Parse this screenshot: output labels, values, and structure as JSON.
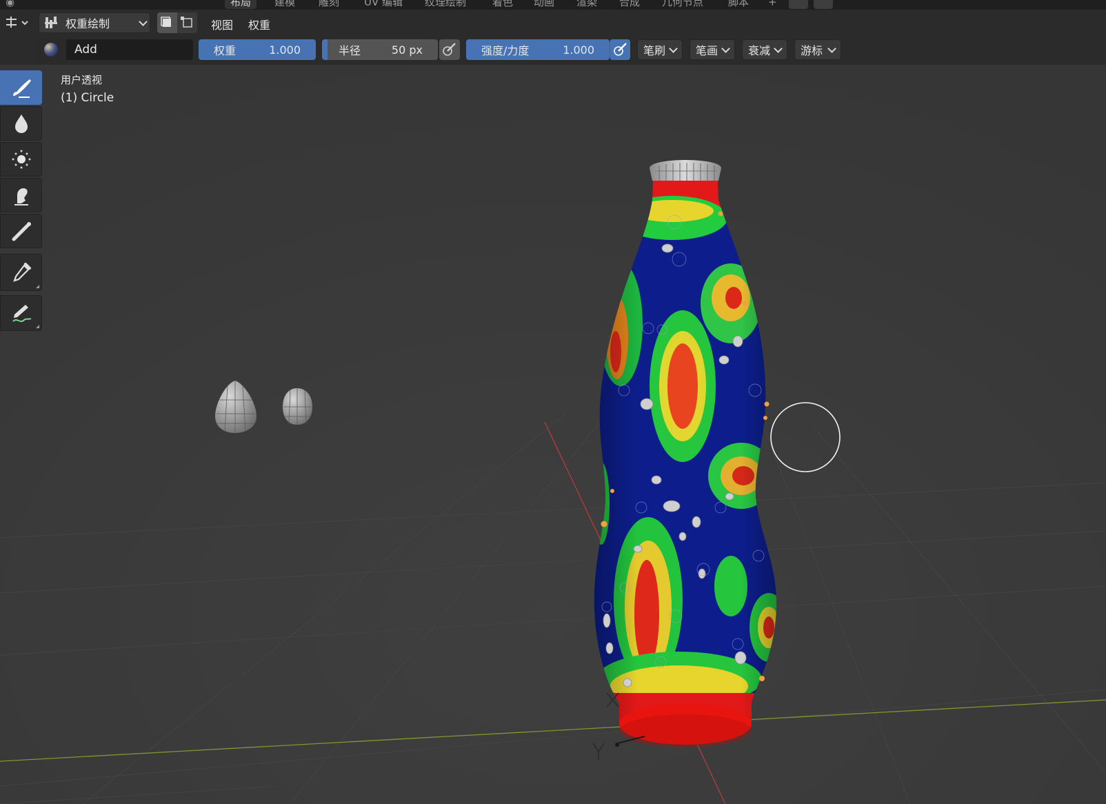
{
  "topbar": {
    "workspace_tabs": [
      "布局",
      "建模",
      "雕刻",
      "UV 编辑",
      "纹理绘制",
      "着色",
      "动画",
      "渲染",
      "合成",
      "几何节点",
      "脚本"
    ],
    "active_tab": "布局",
    "add_tab": "+"
  },
  "header": {
    "mode_label": "权重绘制",
    "menus": [
      "视图",
      "权重"
    ]
  },
  "tool_settings": {
    "blend_mode": "Add",
    "weight_label": "权重",
    "weight_value": "1.000",
    "radius_label": "半径",
    "radius_value": "50 px",
    "strength_label": "强度/力度",
    "strength_value": "1.000",
    "dropdowns": [
      "笔刷",
      "笔画",
      "衰减",
      "游标"
    ]
  },
  "toolbar": {
    "tools": [
      "draw-brush",
      "blur-brush",
      "average-brush",
      "smear-brush",
      "gradient",
      "sample-weight",
      "annotate"
    ],
    "active_tool": "draw-brush"
  },
  "viewport": {
    "view_name": "用户透视",
    "object_name": "(1) Circle",
    "axis_x_label": "X",
    "axis_y_label": "Y"
  },
  "colors": {
    "accent": "#4772b3",
    "background": "#393939",
    "grid_x_axis": "#c83a3a",
    "grid_y_axis": "#7c9a2f"
  }
}
